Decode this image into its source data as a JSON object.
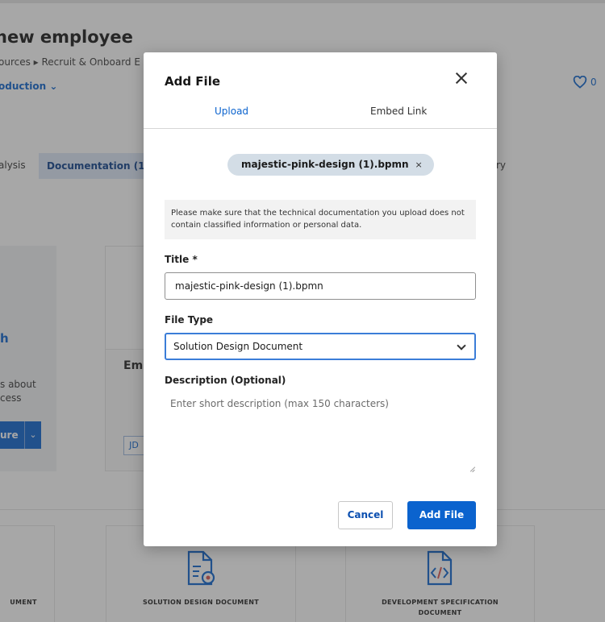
{
  "background": {
    "page_title": "new employee",
    "breadcrumb": "ources ▸ Recruit & Onboard E",
    "environment": "oduction",
    "likes": "0",
    "tabs": {
      "analysis": "alysis",
      "documentation": "Documentation (1)",
      "history": "ry"
    },
    "card_left": {
      "title": "h",
      "desc_line1": "s about",
      "desc_line2": "cess",
      "button": "ure"
    },
    "card_mid": {
      "label": "Emp",
      "initials": "JD"
    },
    "doc_cards": {
      "left": "UMENT",
      "solution": "SOLUTION DESIGN DOCUMENT",
      "dev_line1": "DEVELOPMENT SPECIFICATION",
      "dev_line2": "DOCUMENT"
    }
  },
  "modal": {
    "title": "Add File",
    "tabs": {
      "upload": "Upload",
      "embed": "Embed Link"
    },
    "file_chip": "majestic-pink-design (1).bpmn",
    "file_chip_remove": "×",
    "notice": "Please make sure that the technical documentation you upload does not contain classified information or personal data.",
    "fields": {
      "title_label": "Title *",
      "title_value": "majestic-pink-design (1).bpmn",
      "type_label": "File Type",
      "type_value": "Solution Design Document",
      "desc_label": "Description (Optional)",
      "desc_placeholder": "Enter short description (max 150 characters)"
    },
    "buttons": {
      "cancel": "Cancel",
      "add": "Add File"
    }
  },
  "colors": {
    "accent": "#0b63ce",
    "overlay": "rgba(60,60,60,0.45)"
  }
}
